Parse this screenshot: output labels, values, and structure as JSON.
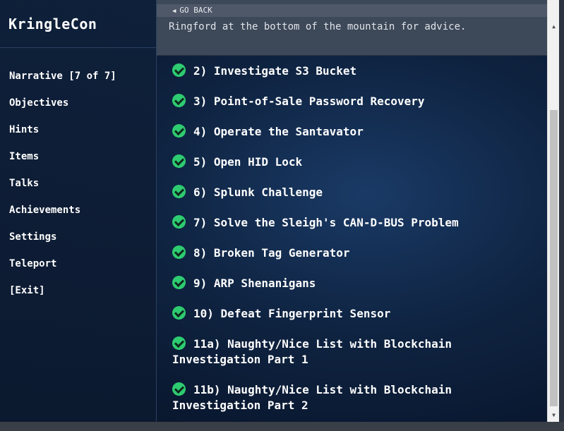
{
  "brand": "KringleCon",
  "nav": [
    "Narrative [7 of 7]",
    "Objectives",
    "Hints",
    "Items",
    "Talks",
    "Achievements",
    "Settings",
    "Teleport",
    "[Exit]"
  ],
  "header": {
    "go_back": "GO BACK",
    "go_back_icon": "triangle-left",
    "text": "Ringford at the bottom of the mountain for advice."
  },
  "objectives": [
    {
      "label": "2) Investigate S3 Bucket",
      "status": "complete"
    },
    {
      "label": "3) Point-of-Sale Password Recovery",
      "status": "complete"
    },
    {
      "label": "4) Operate the Santavator",
      "status": "complete"
    },
    {
      "label": "5) Open HID Lock",
      "status": "complete"
    },
    {
      "label": "6) Splunk Challenge",
      "status": "complete"
    },
    {
      "label": "7) Solve the Sleigh's CAN-D-BUS Problem",
      "status": "complete"
    },
    {
      "label": "8) Broken Tag Generator",
      "status": "complete"
    },
    {
      "label": "9) ARP Shenanigans",
      "status": "complete"
    },
    {
      "label": "10) Defeat Fingerprint Sensor",
      "status": "complete"
    },
    {
      "label": "11a) Naughty/Nice List with Blockchain Investigation Part 1",
      "status": "complete"
    },
    {
      "label": "11b) Naughty/Nice List with Blockchain Investigation Part 2",
      "status": "complete"
    }
  ],
  "colors": {
    "check": "#2ecc71",
    "text": "#ffffff",
    "header_bar": "#3d4858"
  }
}
